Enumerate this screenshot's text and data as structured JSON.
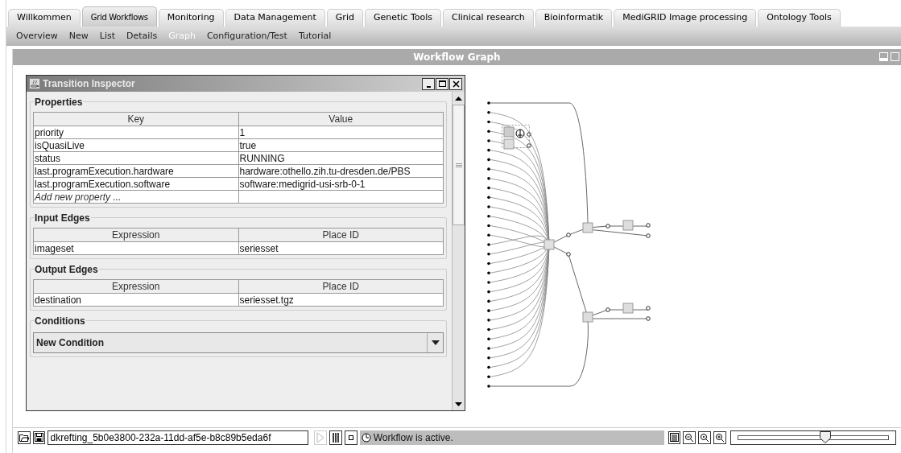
{
  "tabs": [
    {
      "label": "Willkommen",
      "selected": false
    },
    {
      "label": "Grid Workflows",
      "selected": true
    },
    {
      "label": "Monitoring",
      "selected": false
    },
    {
      "label": "Data Management",
      "selected": false
    },
    {
      "label": "Grid",
      "selected": false
    },
    {
      "label": "Genetic Tools",
      "selected": false
    },
    {
      "label": "Clinical research",
      "selected": false
    },
    {
      "label": "Bioinformatik",
      "selected": false
    },
    {
      "label": "MediGRID Image processing",
      "selected": false
    },
    {
      "label": "Ontology Tools",
      "selected": false
    }
  ],
  "subtabs": [
    {
      "label": "Overview",
      "selected": false
    },
    {
      "label": "New",
      "selected": false
    },
    {
      "label": "List",
      "selected": false
    },
    {
      "label": "Details",
      "selected": false
    },
    {
      "label": "Graph",
      "selected": true
    },
    {
      "label": "Configuration/Test",
      "selected": false
    },
    {
      "label": "Tutorial",
      "selected": false
    }
  ],
  "panel": {
    "title": "Workflow Graph"
  },
  "inspector": {
    "title": "Transition Inspector",
    "properties": {
      "title": "Properties",
      "columns": [
        "Key",
        "Value"
      ],
      "rows": [
        [
          "priority",
          "1"
        ],
        [
          "isQuasiLive",
          "true"
        ],
        [
          "status",
          "RUNNING"
        ],
        [
          "last.programExecution.hardware",
          "hardware:othello.zih.tu-dresden.de/PBS"
        ],
        [
          "last.programExecution.software",
          "software:medigrid-usi-srb-0-1"
        ]
      ],
      "add_placeholder": "Add new property ..."
    },
    "input_edges": {
      "title": "Input Edges",
      "columns": [
        "Expression",
        "Place ID"
      ],
      "rows": [
        [
          "imageset",
          "seriesset"
        ]
      ]
    },
    "output_edges": {
      "title": "Output Edges",
      "columns": [
        "Expression",
        "Place ID"
      ],
      "rows": [
        [
          "destination",
          "seriesset.tgz"
        ]
      ]
    },
    "conditions": {
      "title": "Conditions",
      "dropdown": "New Condition"
    }
  },
  "toolbar": {
    "workflow_id": "dkrefting_5b0e3800-232a-11dd-af5e-b8c89b5eda6f",
    "controls": [
      {
        "kind": "play",
        "disabled": true
      },
      {
        "kind": "pause",
        "disabled": false
      },
      {
        "kind": "stop",
        "disabled": false
      }
    ],
    "status": "Workflow is active.",
    "zoom": {
      "level": 0.58
    }
  }
}
